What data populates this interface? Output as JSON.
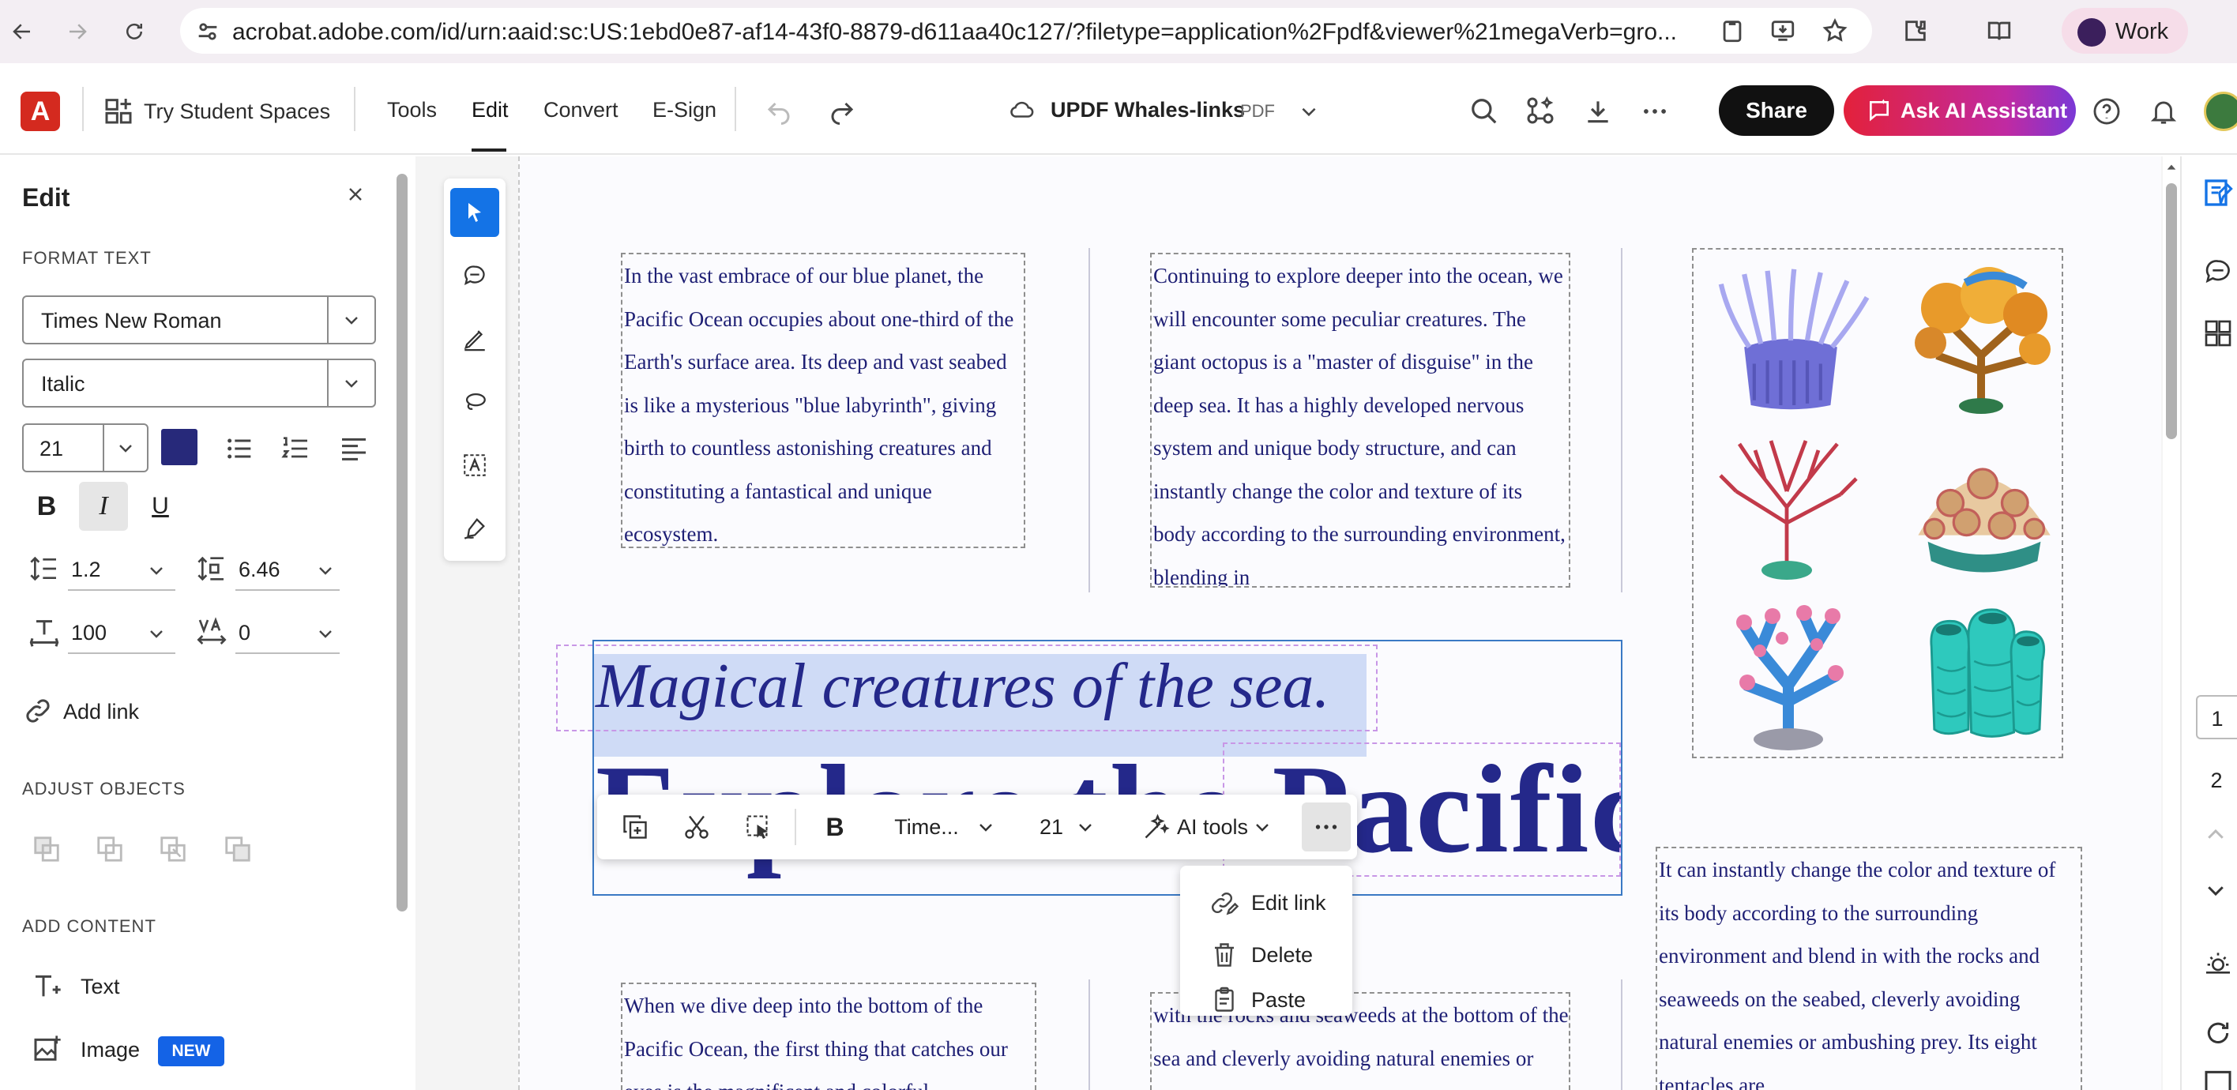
{
  "browser": {
    "url": "acrobat.adobe.com/id/urn:aaid:sc:US:1ebd0e87-af14-43f0-8879-d611aa40c127/?filetype=application%2Fpdf&viewer%21megaVerb=gro...",
    "profile_label": "Work"
  },
  "toolbar": {
    "try_spaces": "Try Student Spaces",
    "tabs": [
      "Tools",
      "Edit",
      "Convert",
      "E-Sign"
    ],
    "active_tab": "Edit",
    "doc_name": "UPDF Whales-links",
    "doc_type": "PDF",
    "share_label": "Share",
    "ai_label": "Ask AI Assistant"
  },
  "edit_panel": {
    "title": "Edit",
    "format_text_label": "FORMAT TEXT",
    "font_family": "Times New Roman",
    "font_style": "Italic",
    "font_size": "21",
    "line_spacing": "1.2",
    "paragraph_spacing": "6.46",
    "horizontal_scale": "100",
    "char_spacing": "0",
    "add_link": "Add link",
    "adjust_objects_label": "ADJUST OBJECTS",
    "add_content_label": "ADD CONTENT",
    "add_text": "Text",
    "add_image": "Image",
    "new_badge": "NEW"
  },
  "document": {
    "col1_top": "In the vast embrace of our blue planet, the Pacific Ocean occupies about one-third of the Earth's surface area. Its deep and vast seabed is like a mysterious \"blue labyrinth\", giving birth to countless astonishing creatures and constituting a fantastical and unique ecosystem.",
    "col2_top": "Continuing to explore deeper into the ocean, we will encounter some peculiar creatures. The giant octopus is a \"master of disguise\" in the deep sea. It has a highly developed nervous system and unique body structure, and can instantly change the color and texture of its body according to the surrounding environment, blending in",
    "subtitle": "Magical creatures of the sea.",
    "big_title": "Explore the Pacific",
    "col3_right": "It can instantly change the color and texture of its body according to the surrounding environment and blend in with the rocks and seaweeds on the seabed, cleverly avoiding natural enemies or ambushing prey. Its eight tentacles are",
    "col1_bottom": "When we dive deep into the bottom of the Pacific Ocean, the first thing that catches our eyes is the magnificent and colorful",
    "col2_bottom": "with the rocks and seaweeds at the bottom of the sea and cleverly avoiding natural enemies or ambushing prey."
  },
  "float_toolbar": {
    "font": "Time...",
    "size": "21",
    "ai_tools": "AI tools"
  },
  "context_menu": {
    "items": [
      "Edit link",
      "Delete",
      "Paste"
    ]
  },
  "pages": {
    "items": [
      "1",
      "2"
    ],
    "current": "1"
  },
  "colors": {
    "text_blue": "#24288a",
    "accent_blue": "#1473e6",
    "adobe_red": "#d42a1f"
  }
}
